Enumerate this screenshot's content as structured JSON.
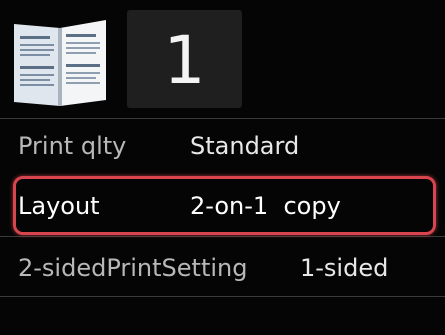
{
  "copies": {
    "value": "1"
  },
  "settings": [
    {
      "label": "Print qlty",
      "value": "Standard",
      "selected": false
    },
    {
      "label": "Layout",
      "value": "2-on-1  copy",
      "selected": true
    },
    {
      "label": "2-sidedPrintSetting",
      "value": "1-sided",
      "selected": false
    }
  ],
  "colors": {
    "background": "#000000",
    "highlight": "#d8454e"
  },
  "icons": {
    "preview": "two-page-layout-preview-icon"
  }
}
